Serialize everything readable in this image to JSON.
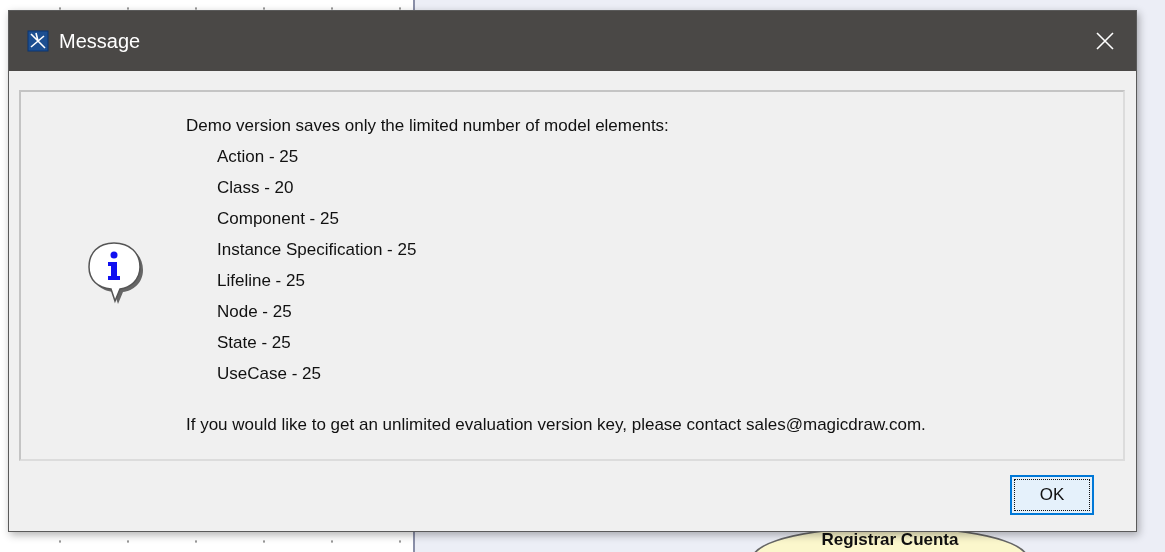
{
  "diagram": {
    "use_case": "Registrar Cuenta"
  },
  "dialog": {
    "title": "Message",
    "intro": "Demo version saves only the limited number of model elements:",
    "limits": [
      "Action - 25",
      "Class - 20",
      "Component - 25",
      "Instance Specification - 25",
      "Lifeline - 25",
      "Node - 25",
      "State - 25",
      "UseCase - 25"
    ],
    "footer": "If you would like to get an unlimited evaluation version key, please contact sales@magicdraw.com.",
    "buttons": [
      {
        "label": "OK",
        "focused": true
      }
    ]
  }
}
